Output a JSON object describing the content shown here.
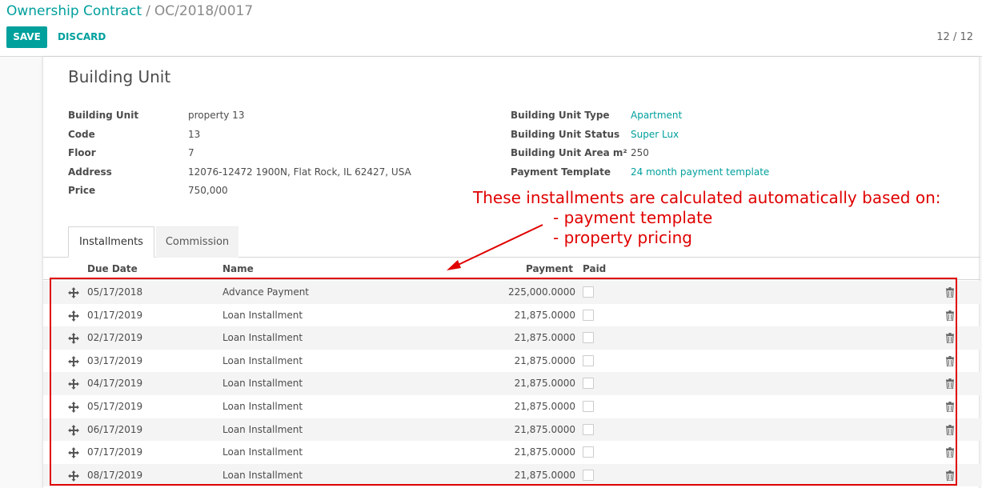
{
  "breadcrumb": {
    "parent": "Ownership Contract",
    "separator": "/",
    "current": "OC/2018/0017"
  },
  "toolbar": {
    "save_label": "SAVE",
    "discard_label": "DISCARD",
    "pager": "12 / 12"
  },
  "sheet": {
    "title": "Building Unit",
    "left_fields": [
      {
        "label": "Building Unit",
        "value": "property 13"
      },
      {
        "label": "Code",
        "value": "13"
      },
      {
        "label": "Floor",
        "value": "7"
      },
      {
        "label": "Address",
        "value": "12076-12472 1900N, Flat Rock, IL 62427, USA"
      },
      {
        "label": "Price",
        "value": "750,000"
      }
    ],
    "right_fields": [
      {
        "label": "Building Unit Type",
        "value": "Apartment"
      },
      {
        "label": "Building Unit Status",
        "value": "Super Lux"
      },
      {
        "label": "Building Unit Area m²",
        "value": "250"
      },
      {
        "label": "Payment Template",
        "value": "24 month payment template"
      }
    ]
  },
  "tabs": [
    {
      "label": "Installments",
      "active": true
    },
    {
      "label": "Commission",
      "active": false
    }
  ],
  "table": {
    "headers": {
      "due_date": "Due Date",
      "name": "Name",
      "payment": "Payment",
      "paid": "Paid"
    },
    "rows": [
      {
        "due_date": "05/17/2018",
        "name": "Advance Payment",
        "payment": "225,000.0000",
        "paid": false
      },
      {
        "due_date": "01/17/2019",
        "name": "Loan Installment",
        "payment": "21,875.0000",
        "paid": false
      },
      {
        "due_date": "02/17/2019",
        "name": "Loan Installment",
        "payment": "21,875.0000",
        "paid": false
      },
      {
        "due_date": "03/17/2019",
        "name": "Loan Installment",
        "payment": "21,875.0000",
        "paid": false
      },
      {
        "due_date": "04/17/2019",
        "name": "Loan Installment",
        "payment": "21,875.0000",
        "paid": false
      },
      {
        "due_date": "05/17/2019",
        "name": "Loan Installment",
        "payment": "21,875.0000",
        "paid": false
      },
      {
        "due_date": "06/17/2019",
        "name": "Loan Installment",
        "payment": "21,875.0000",
        "paid": false
      },
      {
        "due_date": "07/17/2019",
        "name": "Loan Installment",
        "payment": "21,875.0000",
        "paid": false
      },
      {
        "due_date": "08/17/2019",
        "name": "Loan Installment",
        "payment": "21,875.0000",
        "paid": false
      }
    ]
  },
  "annotation": {
    "lines": [
      "These installments are calculated automatically based on:",
      "  - payment template",
      " - property pricing"
    ],
    "color": "#e00000"
  },
  "colors": {
    "accent": "#00a09d",
    "annotation_red": "#e00000"
  },
  "icons": {
    "row_handle": "move-arrows-icon",
    "row_delete": "trash-icon"
  }
}
